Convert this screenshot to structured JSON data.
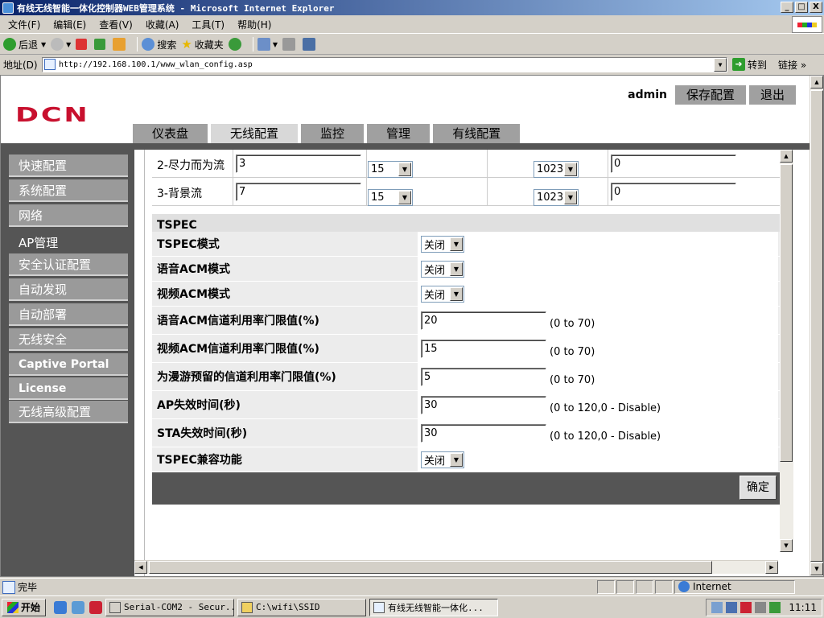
{
  "window": {
    "title": "有线无线智能一体化控制器WEB管理系统 - Microsoft Internet Explorer",
    "controls": [
      "_",
      "□",
      "X"
    ]
  },
  "menu": [
    "文件(F)",
    "编辑(E)",
    "查看(V)",
    "收藏(A)",
    "工具(T)",
    "帮助(H)"
  ],
  "toolbar": {
    "back": "后退",
    "search": "搜索",
    "favorites": "收藏夹"
  },
  "address": {
    "label": "地址(D)",
    "url": "http://192.168.100.1/www_wlan_config.asp",
    "go": "转到",
    "links": "链接"
  },
  "page": {
    "logo": "DCN",
    "user": "admin",
    "save_button": "保存配置",
    "logout_button": "退出",
    "tabs": [
      "仪表盘",
      "无线配置",
      "监控",
      "管理",
      "有线配置"
    ],
    "active_tab": "无线配置"
  },
  "sidebar": {
    "items": [
      "快速配置",
      "系统配置",
      "网络",
      "AP管理",
      "安全认证配置",
      "自动发现",
      "自动部署",
      "无线安全",
      "Captive Portal",
      "License",
      "无线高级配置"
    ]
  },
  "queue_rows": [
    {
      "name": "2-尽力而为流",
      "aifs": "3",
      "cwmin": "15",
      "cwmax": "1023",
      "txop": "0"
    },
    {
      "name": "3-背景流",
      "aifs": "7",
      "cwmin": "15",
      "cwmax": "1023",
      "txop": "0"
    }
  ],
  "tspec": {
    "heading": "TSPEC",
    "fields": [
      {
        "label": "TSPEC模式",
        "type": "select",
        "value": "关闭"
      },
      {
        "label": "语音ACM模式",
        "type": "select",
        "value": "关闭"
      },
      {
        "label": "视频ACM模式",
        "type": "select",
        "value": "关闭"
      },
      {
        "label": "语音ACM信道利用率门限值(%)",
        "type": "input",
        "value": "20",
        "hint": "(0 to 70)"
      },
      {
        "label": "视频ACM信道利用率门限值(%)",
        "type": "input",
        "value": "15",
        "hint": "(0 to 70)"
      },
      {
        "label": "为漫游预留的信道利用率门限值(%)",
        "type": "input",
        "value": "5",
        "hint": "(0 to 70)"
      },
      {
        "label": "AP失效时间(秒)",
        "type": "input",
        "value": "30",
        "hint": "(0 to 120,0 - Disable)"
      },
      {
        "label": "STA失效时间(秒)",
        "type": "input",
        "value": "30",
        "hint": "(0 to 120,0 - Disable)"
      },
      {
        "label": "TSPEC兼容功能",
        "type": "select",
        "value": "关闭"
      }
    ],
    "ok_button": "确定"
  },
  "status": {
    "text": "完毕",
    "zone": "Internet"
  },
  "taskbar": {
    "start": "开始",
    "tasks": [
      "Serial-COM2 - Secur...",
      "C:\\wifi\\SSID",
      "有线无线智能一体化..."
    ],
    "clock": "11:11"
  }
}
